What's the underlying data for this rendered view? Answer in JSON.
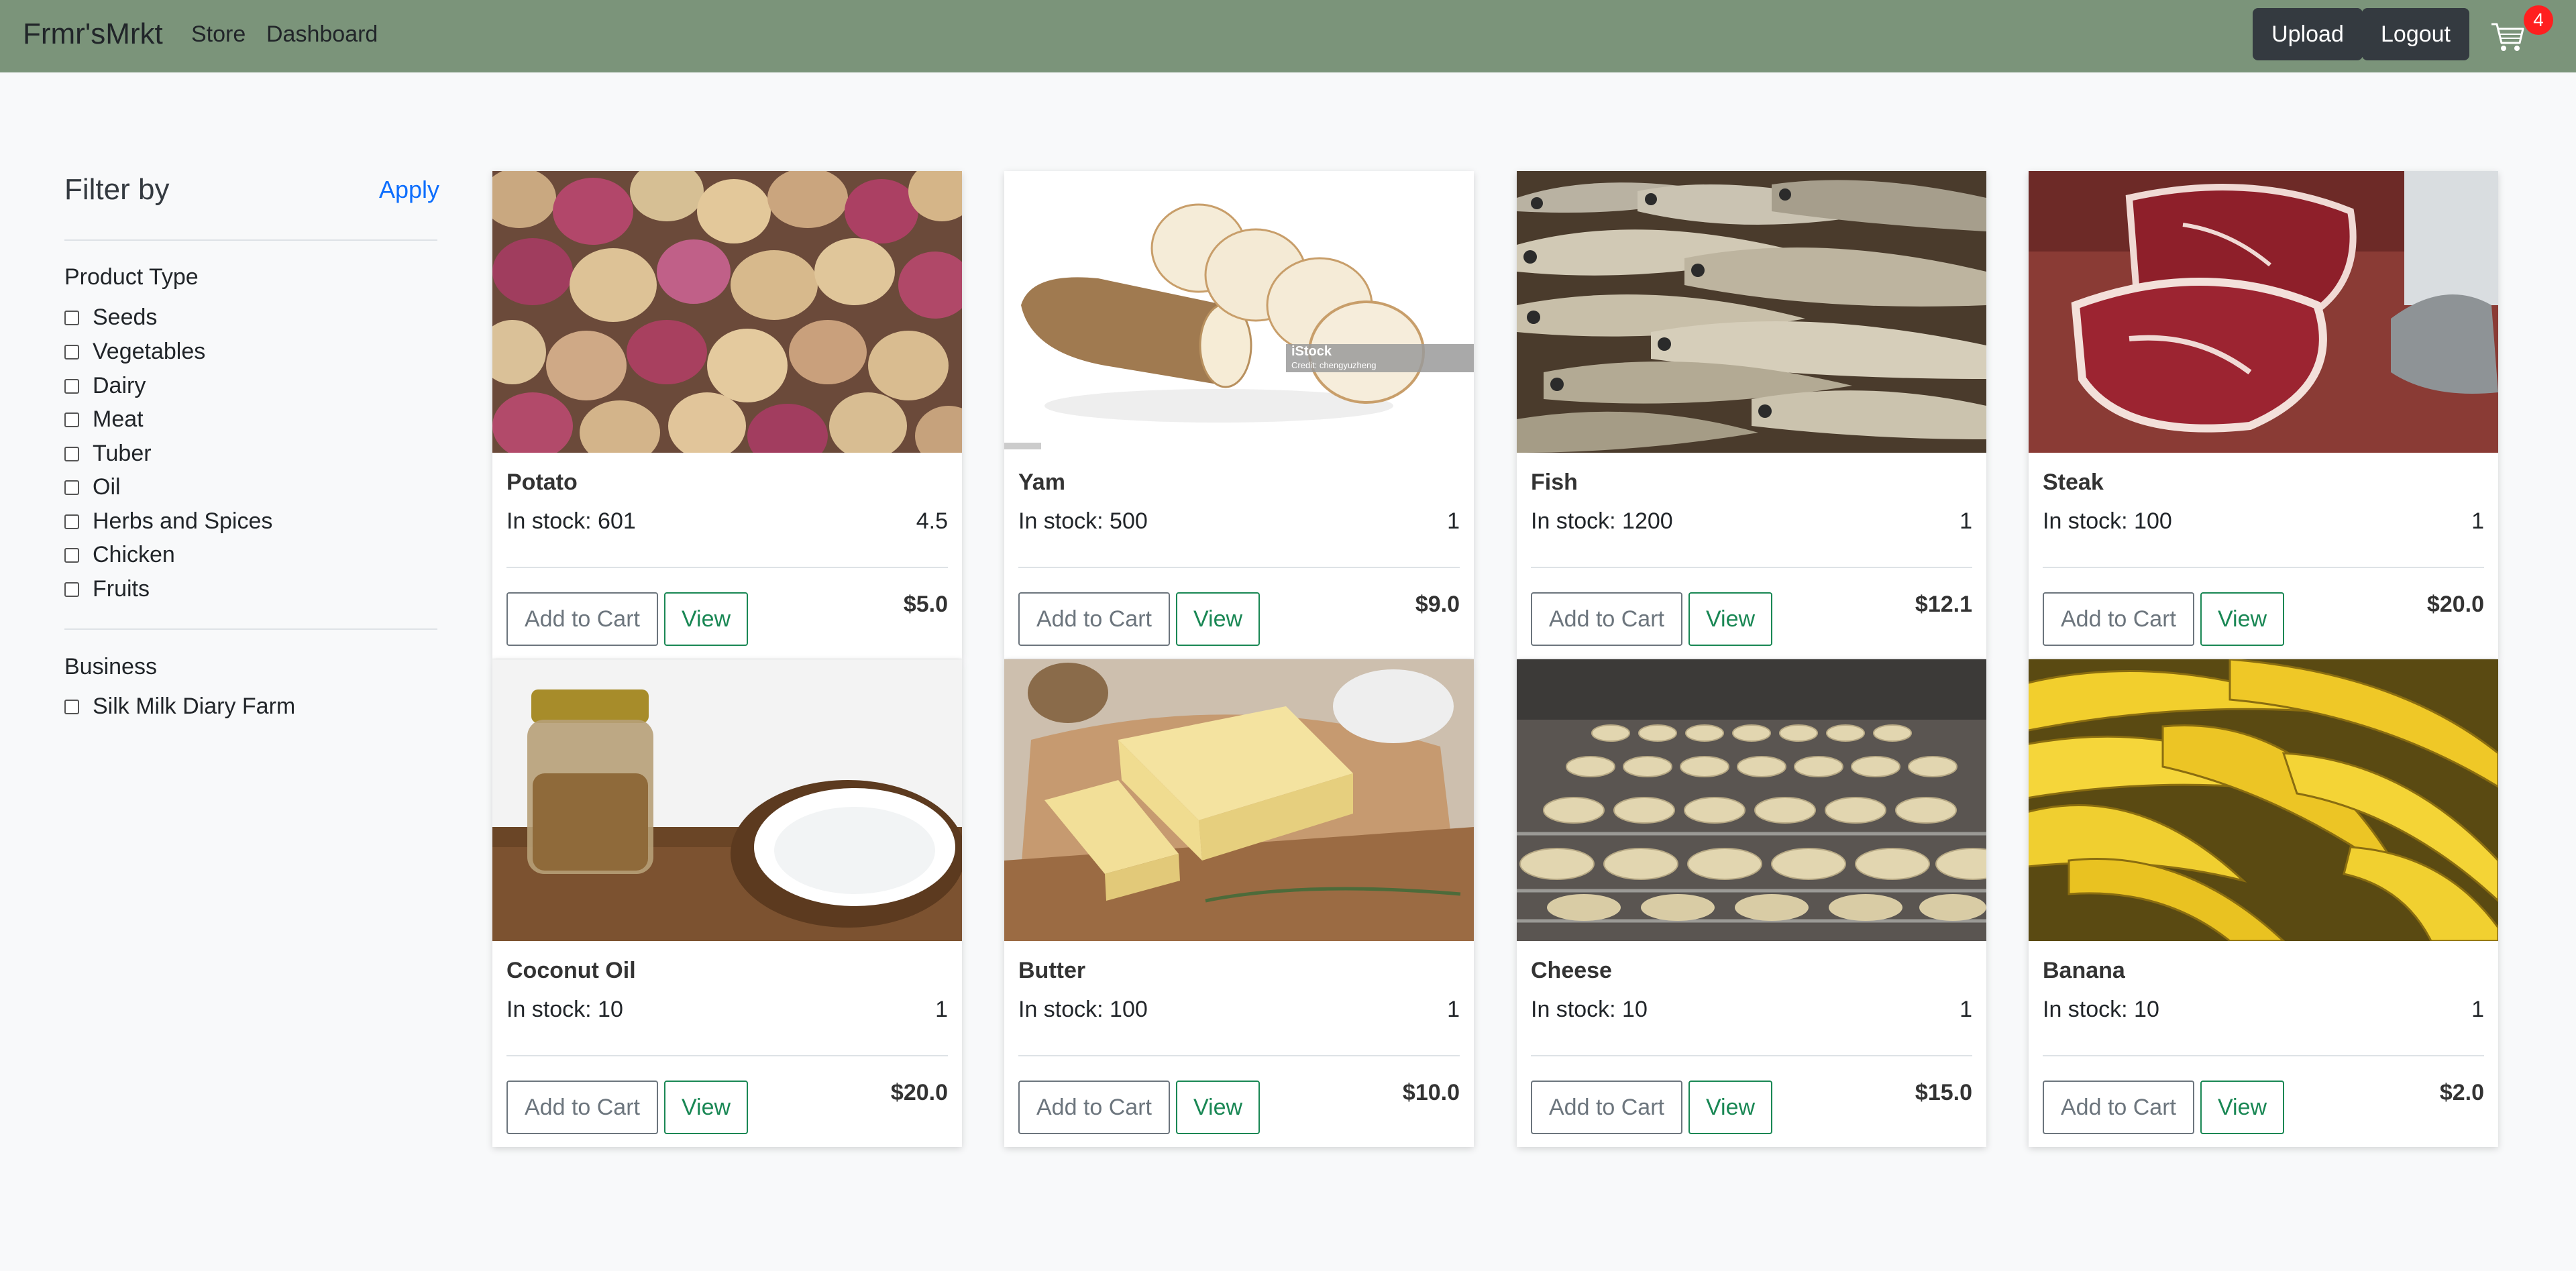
{
  "nav": {
    "brand": "Frmr'sMrkt",
    "links": [
      "Store",
      "Dashboard"
    ],
    "upload": "Upload",
    "logout": "Logout",
    "cart_count": "4",
    "cart_icon": "cart-icon"
  },
  "filter": {
    "title": "Filter by",
    "apply": "Apply",
    "product_type_title": "Product Type",
    "product_types": [
      "Seeds",
      "Vegetables",
      "Dairy",
      "Meat",
      "Tuber",
      "Oil",
      "Herbs and Spices",
      "Chicken",
      "Fruits"
    ],
    "business_title": "Business",
    "businesses": [
      "Silk Milk Diary Farm"
    ]
  },
  "products": [
    {
      "name": "Potato",
      "stock": "In stock: 601",
      "rating": "4.5",
      "price": "$5.0",
      "image": "potatoes-photo"
    },
    {
      "name": "Yam",
      "stock": "In stock: 500",
      "rating": "1",
      "price": "$9.0",
      "image": "yam-photo",
      "watermark": "iStock",
      "credit": "Credit: chengyuzheng"
    },
    {
      "name": "Fish",
      "stock": "In stock: 1200",
      "rating": "1",
      "price": "$12.1",
      "image": "fish-photo"
    },
    {
      "name": "Steak",
      "stock": "In stock: 100",
      "rating": "1",
      "price": "$20.0",
      "image": "steak-photo"
    },
    {
      "name": "Coconut Oil",
      "stock": "In stock: 10",
      "rating": "1",
      "price": "$20.0",
      "image": "coconut-oil-photo"
    },
    {
      "name": "Butter",
      "stock": "In stock: 100",
      "rating": "1",
      "price": "$10.0",
      "image": "butter-photo"
    },
    {
      "name": "Cheese",
      "stock": "In stock: 10",
      "rating": "1",
      "price": "$15.0",
      "image": "cheese-photo"
    },
    {
      "name": "Banana",
      "stock": "In stock: 10",
      "rating": "1",
      "price": "$2.0",
      "image": "banana-photo"
    }
  ],
  "card_actions": {
    "add": "Add to Cart",
    "view": "View"
  }
}
